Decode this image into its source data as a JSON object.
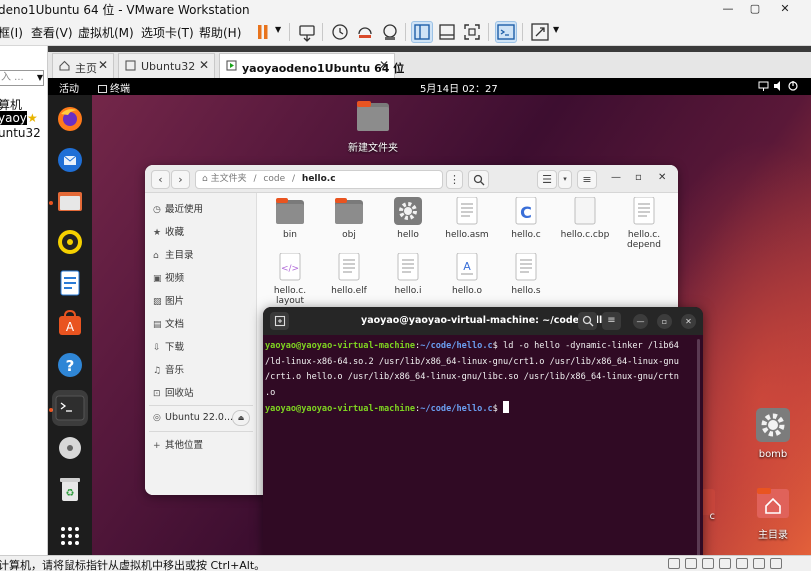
{
  "vmware": {
    "title": "deno1Ubuntu 64 位 - VMware Workstation",
    "window_controls": [
      "—",
      "▢",
      "✕"
    ],
    "menu": [
      "框(I)",
      "查看(V)",
      "虚拟机(M)",
      "选项卡(T)",
      "帮助(H)"
    ],
    "library": {
      "search_placeholder": "入 ...",
      "items": [
        "算机",
        "yaoy",
        "untu32"
      ]
    },
    "tabs": [
      {
        "label": "主页"
      },
      {
        "label": "Ubuntu32"
      },
      {
        "label": "yaoyaodeno1Ubuntu 64 位"
      }
    ],
    "status_message": "计算机，请将鼠标指针从虚拟机中移出或按 Ctrl+Alt。"
  },
  "gnome": {
    "activities": "活动",
    "app_name": "终端",
    "clock": "5月14日  02：27"
  },
  "desktop": {
    "icons": [
      {
        "label": "新建文件夹"
      },
      {
        "label": "bomb"
      },
      {
        "label": "主目录"
      },
      {
        "label": "c"
      }
    ]
  },
  "files": {
    "path_home": "主文件夹",
    "path_sep": "/",
    "path_code": "code",
    "path_current": "hello.c",
    "sidebar": [
      {
        "label": "最近使用",
        "icon": "clock-icon"
      },
      {
        "label": "收藏",
        "icon": "star-icon"
      },
      {
        "label": "主目录",
        "icon": "home-icon"
      },
      {
        "label": "视频",
        "icon": "video-icon"
      },
      {
        "label": "图片",
        "icon": "image-icon"
      },
      {
        "label": "文档",
        "icon": "document-icon"
      },
      {
        "label": "下载",
        "icon": "download-icon"
      },
      {
        "label": "音乐",
        "icon": "music-icon"
      },
      {
        "label": "回收站",
        "icon": "trash-icon"
      },
      {
        "label": "Ubuntu 22.0...",
        "icon": "disc-icon"
      },
      {
        "label": "其他位置",
        "icon": "plus-icon"
      }
    ],
    "items": [
      {
        "name": "bin",
        "kind": "folder"
      },
      {
        "name": "obj",
        "kind": "folder"
      },
      {
        "name": "hello",
        "kind": "exec"
      },
      {
        "name": "hello.asm",
        "kind": "text"
      },
      {
        "name": "hello.c",
        "kind": "c"
      },
      {
        "name": "hello.c.cbp",
        "kind": "blank"
      },
      {
        "name": "hello.c.\ndepend",
        "kind": "text"
      },
      {
        "name": "hello.c.\nlayout",
        "kind": "xml"
      },
      {
        "name": "hello.elf",
        "kind": "text"
      },
      {
        "name": "hello.i",
        "kind": "text"
      },
      {
        "name": "hello.o",
        "kind": "obj"
      },
      {
        "name": "hello.s",
        "kind": "text"
      }
    ]
  },
  "terminal": {
    "title": "yaoyao@yaoyao-virtual-machine: ~/code/hello.c",
    "prompt_user": "yaoyao@yaoyao-virtual-machine",
    "prompt_colon": ":",
    "prompt_path": "~/code/hello.c",
    "prompt_dollar": "$",
    "cmd_line1": " ld -o hello -dynamic-linker /lib64",
    "lines": [
      "/ld-linux-x86-64.so.2 /usr/lib/x86_64-linux-gnu/crt1.o /usr/lib/x86_64-linux-gnu",
      "/crti.o hello.o /usr/lib/x86_64-linux-gnu/libc.so /usr/lib/x86_64-linux-gnu/crtn",
      ".o"
    ]
  },
  "colors": {
    "terminal_bg": "#300a24",
    "prompt_user": "#7ed321",
    "prompt_path": "#6a9ef0",
    "ubuntu_orange": "#e95420"
  }
}
